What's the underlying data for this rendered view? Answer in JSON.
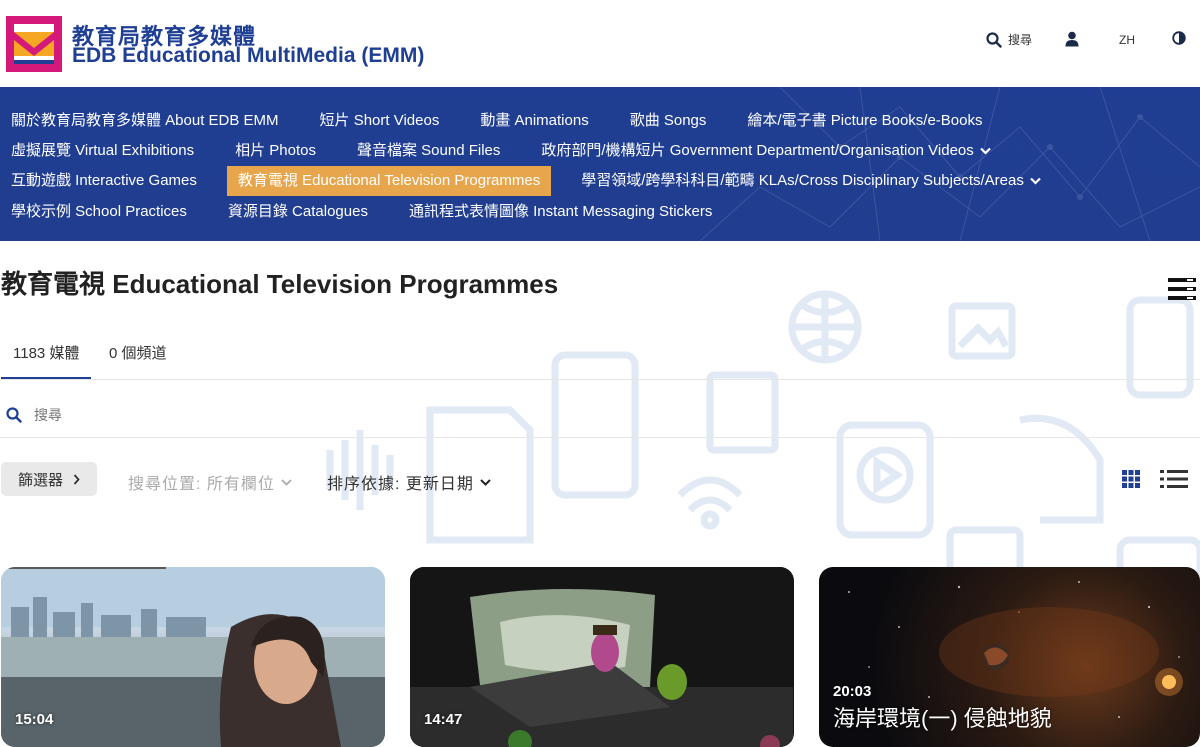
{
  "header": {
    "logo_zh": "教育局教育多媒體",
    "logo_en": "EDB Educational MultiMedia (EMM)",
    "search_label": "搜尋",
    "lang_label": "ZH"
  },
  "nav": {
    "row1": [
      "關於教育局教育多媒體 About EDB EMM",
      "短片 Short Videos",
      "動畫 Animations",
      "歌曲 Songs",
      "繪本/電子書 Picture Books/e-Books"
    ],
    "row2": [
      "虛擬展覽 Virtual Exhibitions",
      "相片 Photos",
      "聲音檔案 Sound Files",
      "政府部門/機構短片 Government Department/Organisation Videos"
    ],
    "row3": [
      "互動遊戲 Interactive Games",
      "教育電視 Educational Television Programmes",
      "學習領域/跨學科科目/範疇 KLAs/Cross Disciplinary Subjects/Areas"
    ],
    "row4": [
      "學校示例 School Practices",
      "資源目錄 Catalogues",
      "通訊程式表情圖像 Instant Messaging Stickers"
    ]
  },
  "page": {
    "title": "教育電視 Educational Television Programmes",
    "tab_media": "1183 媒體",
    "tab_channels": "0 個頻道",
    "search_placeholder": "搜尋",
    "filter_label": "篩選器",
    "search_location": "搜尋位置: 所有欄位",
    "sort_by": "排序依據: 更新日期"
  },
  "cards": [
    {
      "duration": "15:04",
      "title": ""
    },
    {
      "duration": "14:47",
      "title": ""
    },
    {
      "duration": "20:03",
      "title": "海岸環境(一) 侵蝕地貌"
    }
  ],
  "colors": {
    "brand_blue": "#1f3f95",
    "nav_active": "#e8a64c",
    "logo_magenta": "#d4197a"
  }
}
